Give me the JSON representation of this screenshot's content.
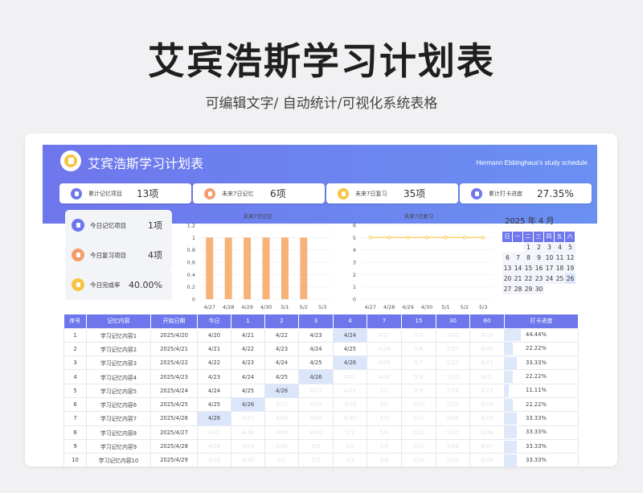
{
  "header": {
    "title": "艾宾浩斯学习计划表",
    "subtitle": "可编辑文字/ 自动统计/可视化系统表格"
  },
  "banner": {
    "title": "艾宾浩斯学习计划表",
    "subtitle": "Hermann Ebbinghaus's study schedule"
  },
  "colors": {
    "primary": "#6e76ec",
    "bar": "#f7b27a",
    "line": "#f5c542",
    "highlight": "#dce6fb"
  },
  "stats": [
    {
      "label": "累计记忆项目",
      "value": "13项",
      "icon": "document-icon",
      "color": "#6e76ec"
    },
    {
      "label": "未来7日记忆",
      "value": "6项",
      "icon": "document-icon",
      "color": "#f29d6b"
    },
    {
      "label": "未来7日复习",
      "value": "35项",
      "icon": "document-icon",
      "color": "#f5c542"
    },
    {
      "label": "累计打卡进度",
      "value": "27.35%",
      "icon": "document-icon",
      "color": "#6e76ec"
    }
  ],
  "today": [
    {
      "label": "今日记忆项目",
      "value": "1项",
      "icon": "document-icon",
      "color": "#6e76ec"
    },
    {
      "label": "今日复习项目",
      "value": "4项",
      "icon": "document-icon",
      "color": "#f29d6b"
    },
    {
      "label": "今日完成率",
      "value": "40.00%",
      "icon": "document-icon",
      "color": "#f5c542"
    }
  ],
  "chart_data": [
    {
      "type": "bar",
      "title": "未来7日记忆",
      "categories": [
        "4/27",
        "4/28",
        "4/29",
        "4/30",
        "5/1",
        "5/2",
        "5/3"
      ],
      "values": [
        1,
        1,
        1,
        1,
        1,
        1,
        0
      ],
      "ylim": [
        0,
        1.2
      ],
      "yticks": [
        "0",
        "0.2",
        "0.4",
        "0.6",
        "0.8",
        "1",
        "1.2"
      ],
      "grid": true
    },
    {
      "type": "line",
      "title": "未来7日复习",
      "categories": [
        "4/27",
        "4/28",
        "4/29",
        "4/30",
        "5/1",
        "5/2",
        "5/3"
      ],
      "values": [
        5,
        5,
        5,
        5,
        5,
        5,
        5
      ],
      "ylim": [
        0,
        6
      ],
      "yticks": [
        "0",
        "1",
        "2",
        "3",
        "4",
        "5",
        "6"
      ],
      "grid": true
    }
  ],
  "calendar": {
    "year": "2025",
    "year_unit": "年",
    "month": "4",
    "month_unit": "月",
    "weekdays": [
      "日",
      "一",
      "二",
      "三",
      "四",
      "五",
      "六"
    ],
    "weeks": [
      [
        "",
        "",
        "1",
        "2",
        "3",
        "4",
        "5"
      ],
      [
        "6",
        "7",
        "8",
        "9",
        "10",
        "11",
        "12"
      ],
      [
        "13",
        "14",
        "15",
        "16",
        "17",
        "18",
        "19"
      ],
      [
        "20",
        "21",
        "22",
        "23",
        "24",
        "25",
        "26"
      ],
      [
        "27",
        "28",
        "29",
        "30",
        "",
        "",
        ""
      ]
    ],
    "highlighted_day": "26"
  },
  "table": {
    "headers": [
      "序号",
      "记忆内容",
      "开始日期",
      "今日",
      "1",
      "2",
      "3",
      "4",
      "7",
      "15",
      "30",
      "60",
      "打卡进度"
    ],
    "rows": [
      {
        "no": "1",
        "content": "学习记忆内容1",
        "start": "2025/4/20",
        "d": [
          "4/20",
          "4/21",
          "4/22",
          "4/23",
          "4/24",
          "4/27",
          "5/5",
          "5/20",
          "6/19"
        ],
        "progress": 0.4444,
        "progress_text": "44.44%",
        "active": 5,
        "hl": 4
      },
      {
        "no": "2",
        "content": "学习记忆内容2",
        "start": "2025/4/21",
        "d": [
          "4/21",
          "4/22",
          "4/23",
          "4/24",
          "4/25",
          "4/28",
          "5/6",
          "5/21",
          "6/20"
        ],
        "progress": 0.2222,
        "progress_text": "22.22%",
        "active": 5,
        "hl": -1
      },
      {
        "no": "3",
        "content": "学习记忆内容3",
        "start": "2025/4/22",
        "d": [
          "4/22",
          "4/23",
          "4/24",
          "4/25",
          "4/26",
          "4/29",
          "5/7",
          "5/22",
          "6/21"
        ],
        "progress": 0.3333,
        "progress_text": "33.33%",
        "active": 5,
        "hl": 4
      },
      {
        "no": "4",
        "content": "学习记忆内容4",
        "start": "2025/4/23",
        "d": [
          "4/23",
          "4/24",
          "4/25",
          "4/26",
          "4/27",
          "4/30",
          "5/8",
          "5/23",
          "6/22"
        ],
        "progress": 0.2222,
        "progress_text": "22.22%",
        "active": 4,
        "hl": 3
      },
      {
        "no": "5",
        "content": "学习记忆内容5",
        "start": "2025/4/24",
        "d": [
          "4/24",
          "4/25",
          "4/26",
          "4/27",
          "4/28",
          "5/1",
          "5/9",
          "5/24",
          "6/23"
        ],
        "progress": 0.1111,
        "progress_text": "11.11%",
        "active": 3,
        "hl": 2
      },
      {
        "no": "6",
        "content": "学习记忆内容6",
        "start": "2025/4/25",
        "d": [
          "4/25",
          "4/26",
          "4/27",
          "4/28",
          "4/29",
          "5/2",
          "5/10",
          "5/25",
          "6/24"
        ],
        "progress": 0.2222,
        "progress_text": "22.22%",
        "active": 2,
        "hl": 1
      },
      {
        "no": "7",
        "content": "学习记忆内容7",
        "start": "2025/4/26",
        "d": [
          "4/26",
          "4/27",
          "4/28",
          "4/29",
          "4/30",
          "5/3",
          "5/11",
          "5/26",
          "6/25"
        ],
        "progress": 0.3333,
        "progress_text": "33.33%",
        "active": 1,
        "hl": 0
      },
      {
        "no": "8",
        "content": "学习记忆内容8",
        "start": "2025/4/27",
        "d": [
          "4/27",
          "4/28",
          "4/29",
          "4/30",
          "5/1",
          "5/4",
          "5/12",
          "5/27",
          "6/26"
        ],
        "progress": 0.3333,
        "progress_text": "33.33%",
        "active": 0,
        "hl": -1
      },
      {
        "no": "9",
        "content": "学习记忆内容9",
        "start": "2025/4/28",
        "d": [
          "4/28",
          "4/29",
          "4/30",
          "5/1",
          "5/2",
          "5/5",
          "5/13",
          "5/28",
          "6/27"
        ],
        "progress": 0.3333,
        "progress_text": "33.33%",
        "active": 0,
        "hl": -1
      },
      {
        "no": "10",
        "content": "学习记忆内容10",
        "start": "2025/4/29",
        "d": [
          "4/29",
          "4/30",
          "5/1",
          "5/2",
          "5/3",
          "5/6",
          "5/14",
          "5/29",
          "6/28"
        ],
        "progress": 0.3333,
        "progress_text": "33.33%",
        "active": 0,
        "hl": -1
      }
    ]
  }
}
